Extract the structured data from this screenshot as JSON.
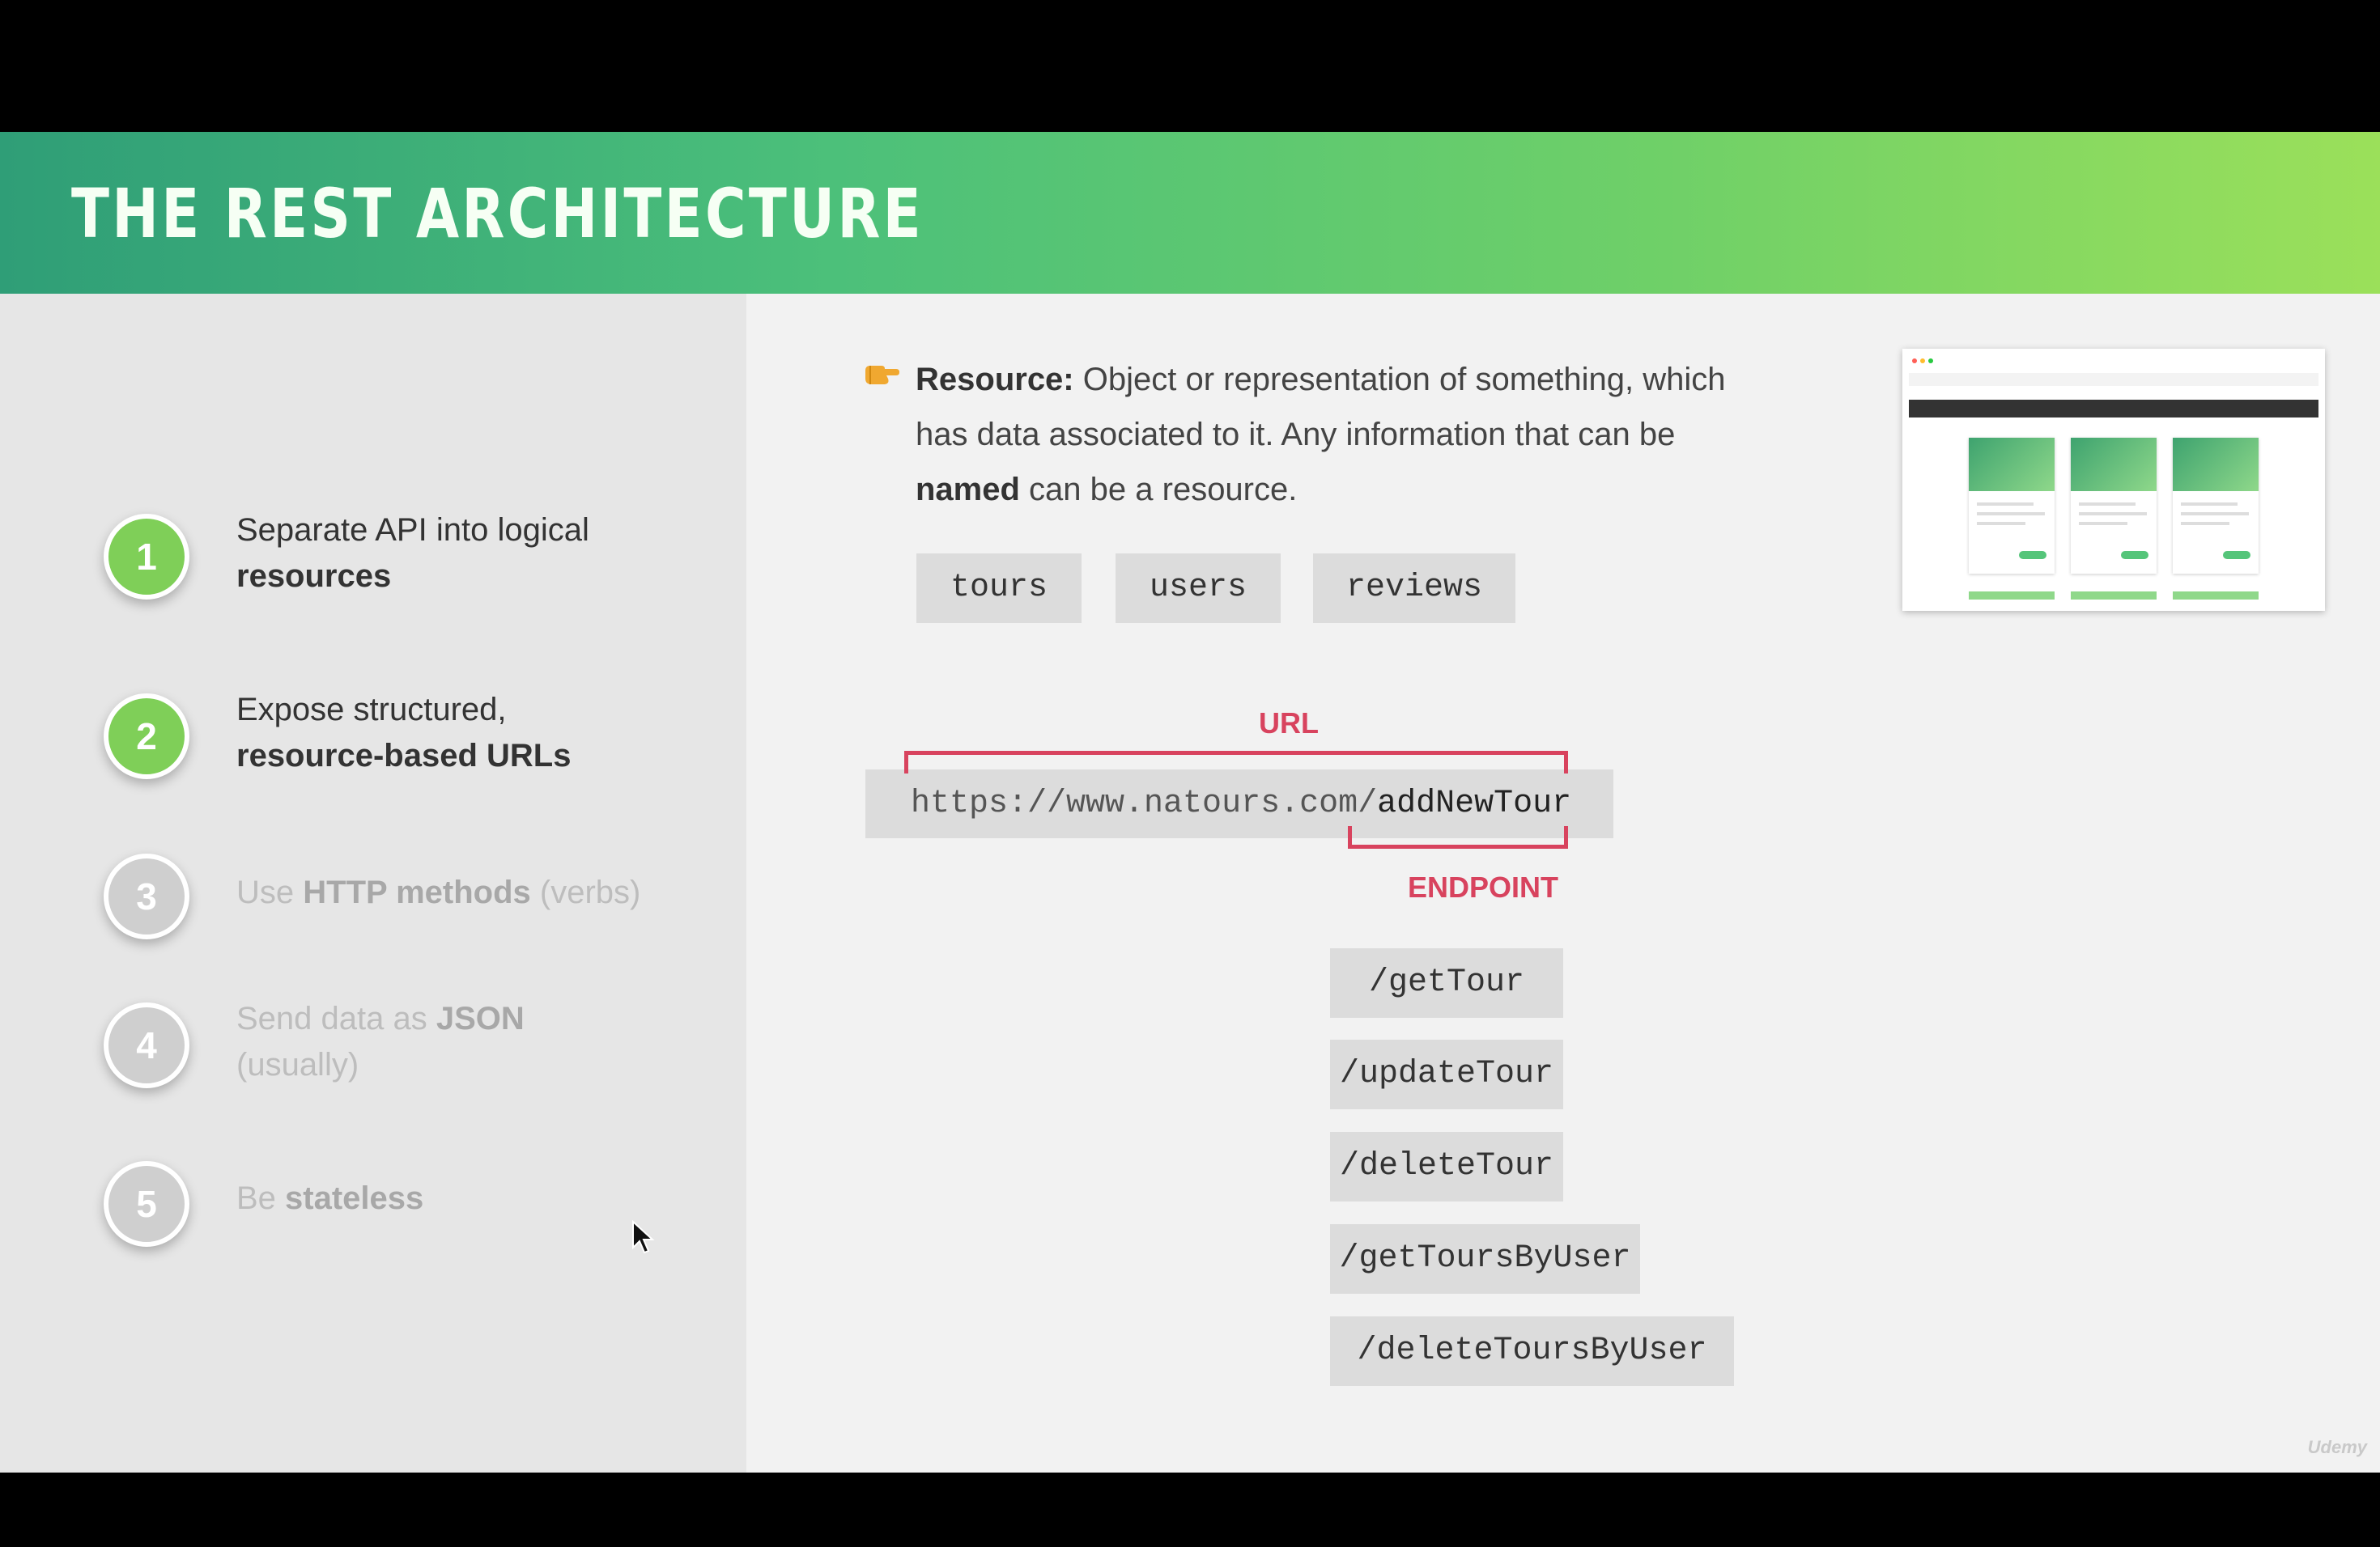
{
  "header": {
    "title": "THE REST ARCHITECTURE"
  },
  "steps": [
    {
      "number": "1",
      "line1": "Separate API into logical",
      "bold": "resources",
      "state": "active"
    },
    {
      "number": "2",
      "line1": "Expose structured,",
      "bold": "resource-based URLs",
      "state": "active"
    },
    {
      "number": "3",
      "pre": "Use ",
      "bold": "HTTP methods",
      "post": " (verbs)",
      "state": "inactive"
    },
    {
      "number": "4",
      "pre": "Send data as ",
      "bold": "JSON",
      "line2": "(usually)",
      "state": "inactive"
    },
    {
      "number": "5",
      "pre": "Be ",
      "bold": "stateless",
      "state": "inactive"
    }
  ],
  "resource": {
    "label": "Resource:",
    "text1": " Object or representation of something, which has data associated to it. Any information that can be ",
    "bold2": "named",
    "text2": " can be a resource."
  },
  "resource_pills": [
    "tours",
    "users",
    "reviews"
  ],
  "url_diagram": {
    "url_label": "URL",
    "endpoint_label": "ENDPOINT",
    "base": "https://www.natours.com/",
    "endpoint": "addNewTour"
  },
  "endpoints": [
    "/getTour",
    "/updateTour",
    "/deleteTour",
    "/getToursByUser",
    "/deleteToursByUser"
  ],
  "watermark": "Udemy",
  "colors": {
    "accent_red": "#d8435e",
    "active_green": "#7fcf58",
    "inactive_gray": "#cfcfcf"
  },
  "icons": [
    "pointing-hand-icon",
    "mouse-cursor-icon"
  ]
}
